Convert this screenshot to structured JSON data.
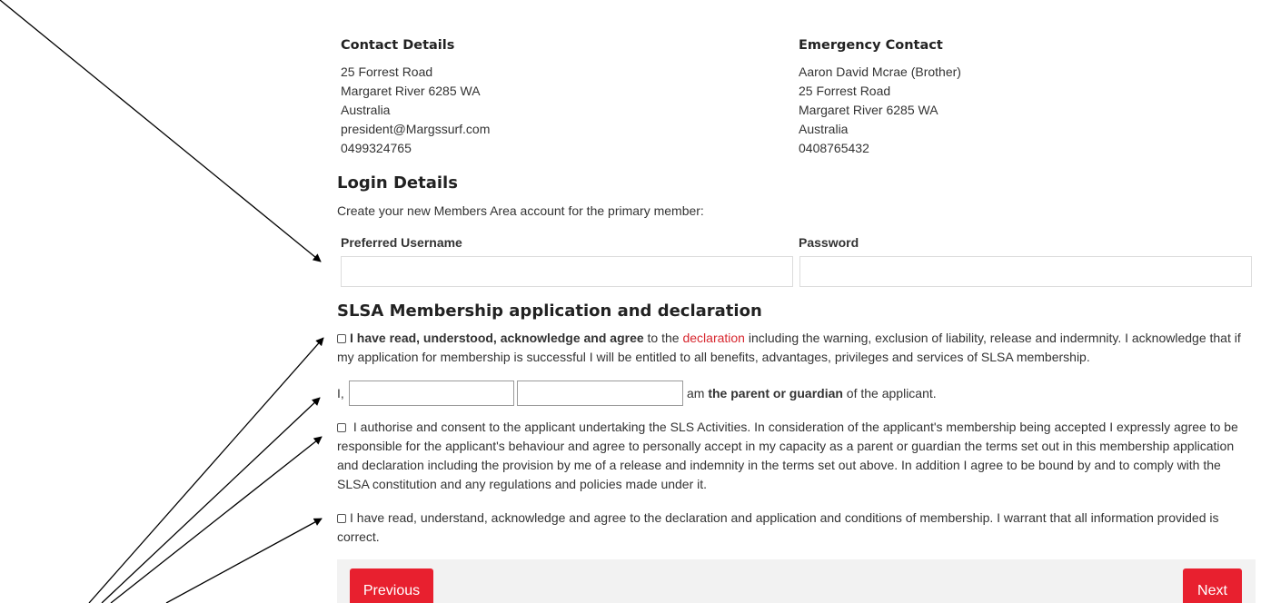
{
  "contact": {
    "heading": "Contact Details",
    "lines": [
      "25 Forrest Road",
      "Margaret River 6285 WA",
      "Australia",
      "president@Margssurf.com",
      "0499324765"
    ]
  },
  "emergency": {
    "heading": "Emergency Contact",
    "lines": [
      "Aaron David Mcrae (Brother)",
      "25 Forrest Road",
      "Margaret River 6285 WA",
      "Australia",
      "0408765432"
    ]
  },
  "login": {
    "heading": "Login Details",
    "subtitle": "Create your new Members Area account for the primary member:",
    "username_label": "Preferred Username",
    "username_value": "",
    "password_label": "Password",
    "password_value": ""
  },
  "declaration": {
    "heading": "SLSA Membership application and declaration",
    "item1_bold": "I have read, understood, acknowledge and agree",
    "item1_pre": " to the ",
    "item1_link": "declaration",
    "item1_rest": " including the warning, exclusion of liability, release and indermnity. I acknowledge that if my application for membership is successful I will be entitled to all benefits, advantages, privileges and services of SLSA membership.",
    "guardian_prefix": "I,",
    "guardian_first_value": "",
    "guardian_last_value": "",
    "guardian_mid": "am ",
    "guardian_bold": "the parent or guardian",
    "guardian_suffix": " of the applicant.",
    "item2_text": "I authorise and consent to the applicant undertaking the SLS Activities. In consideration of the applicant's membership being accepted I expressly agree to be responsible for the applicant's behaviour and agree to personally accept in my capacity as a parent or guardian the terms set out in this membership application and declaration including the provision by me of a release and indemnity in the terms set out above. In addition I agree to be bound by and to comply with the SLSA constitution and any regulations and policies made under it.",
    "item3_text": "I have read, understand, acknowledge and agree to the declaration and application and conditions of membership. I warrant that all information provided is correct."
  },
  "nav": {
    "previous_label": "Previous",
    "next_label": "Next"
  },
  "colors": {
    "accent": "#e8202f",
    "link": "#d7262e",
    "footer_bg": "#f2f2f2"
  }
}
